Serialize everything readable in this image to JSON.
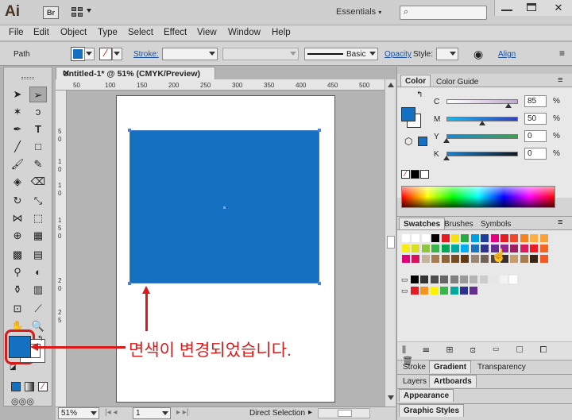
{
  "titlebar": {
    "logo": "Ai",
    "bridge": "Br",
    "workspace": "Essentials"
  },
  "menu": [
    "File",
    "Edit",
    "Object",
    "Type",
    "Select",
    "Effect",
    "View",
    "Window",
    "Help"
  ],
  "control": {
    "selection": "Path",
    "stroke": "Stroke:",
    "brush": "Basic",
    "opacity": "Opacity",
    "style": "Style:",
    "align": "Align"
  },
  "document": {
    "tab": "Untitled-1* @ 51% (CMYK/Preview)",
    "zoom": "51%",
    "artboard_num": "1",
    "status": "Direct Selection"
  },
  "ruler_top": [
    "50",
    "100",
    "150",
    "200",
    "250",
    "300",
    "350",
    "400",
    "450",
    "500"
  ],
  "ruler_left": [
    "5",
    "0",
    "1",
    "0",
    "1",
    "0",
    "1",
    "5",
    "0",
    "2",
    "0",
    "2",
    "5"
  ],
  "color_panel": {
    "tabs": [
      "Color",
      "Color Guide"
    ],
    "fill_color": "#1472c4",
    "channels": [
      {
        "label": "C",
        "value": "85",
        "pos": 0.85
      },
      {
        "label": "M",
        "value": "50",
        "pos": 0.5
      },
      {
        "label": "Y",
        "value": "0",
        "pos": 0
      },
      {
        "label": "K",
        "value": "0",
        "pos": 0
      }
    ]
  },
  "swatches_panel": {
    "tabs": [
      "Swatches",
      "Brushes",
      "Symbols"
    ]
  },
  "panels": {
    "stroke_tabs": [
      "Stroke",
      "Gradient",
      "Transparency"
    ],
    "layers_tabs": [
      "Layers",
      "Artboards"
    ],
    "appearance": "Appearance",
    "graphic_styles": "Graphic Styles"
  },
  "annotation": "면색이 변경되었습니다.",
  "colors": {
    "fill": "#1470c0",
    "annotation": "#d81a1a"
  }
}
